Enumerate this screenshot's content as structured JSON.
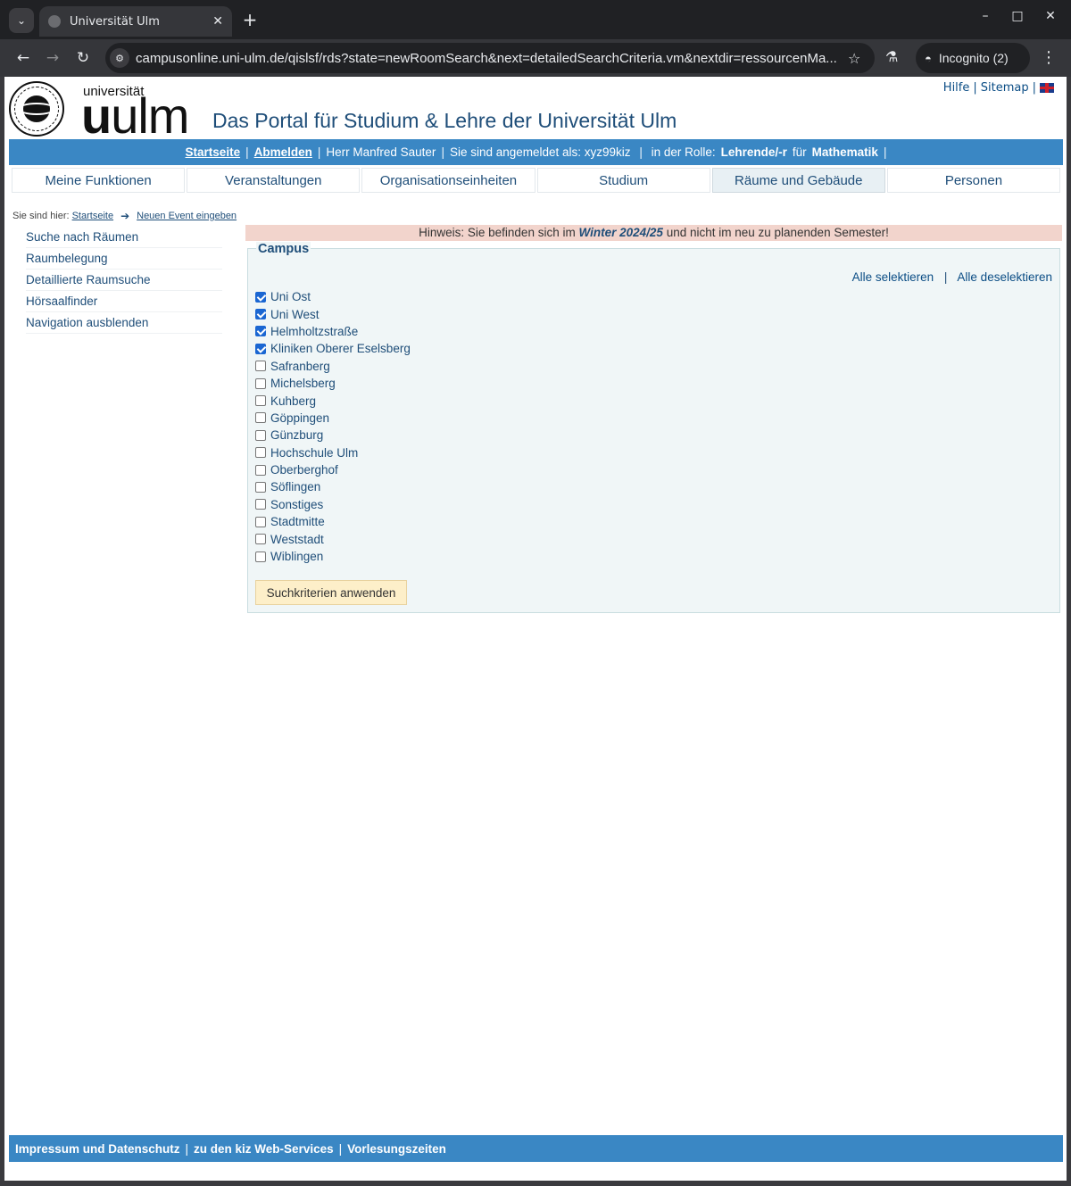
{
  "browser": {
    "tab_title": "Universität Ulm",
    "url": "campusonline.uni-ulm.de/qislsf/rds?state=newRoomSearch&next=detailedSearchCriteria.vm&nextdir=ressourcenMa...",
    "incognito_label": "Incognito (2)"
  },
  "header": {
    "logo_small": "universität",
    "logo_big_bold": "u",
    "logo_big_rest": "ulm",
    "portal_title": "Das Portal für Studium & Lehre der Universität Ulm",
    "help": "Hilfe",
    "sitemap": "Sitemap"
  },
  "userbar": {
    "home": "Startseite",
    "logout": "Abmelden",
    "user": "Herr Manfred Sauter",
    "logged_in_as": "Sie sind angemeldet als: xyz99kiz",
    "role_prefix": "in der Rolle:",
    "role": "Lehrende/-r",
    "for": "für",
    "dept": "Mathematik"
  },
  "mainnav": [
    {
      "label": "Meine Funktionen"
    },
    {
      "label": "Veranstaltungen"
    },
    {
      "label": "Organisationseinheiten"
    },
    {
      "label": "Studium"
    },
    {
      "label": "Räume und Gebäude"
    },
    {
      "label": "Personen"
    }
  ],
  "breadcrumb": {
    "prefix": "Sie sind hier:",
    "home": "Startseite",
    "current": "Neuen Event eingeben"
  },
  "sidenav": [
    {
      "label": "Suche nach Räumen"
    },
    {
      "label": "Raumbelegung"
    },
    {
      "label": "Detaillierte Raumsuche"
    },
    {
      "label": "Hörsaalfinder"
    },
    {
      "label": "Navigation ausblenden"
    }
  ],
  "notice": {
    "before": "Hinweis: Sie befinden sich im",
    "semester": "Winter 2024/25",
    "after": "und nicht im neu zu planenden Semester!"
  },
  "campus": {
    "legend": "Campus",
    "select_all": "Alle selektieren",
    "deselect_all": "Alle deselektieren",
    "items": [
      {
        "label": "Uni Ost",
        "checked": true
      },
      {
        "label": "Uni West",
        "checked": true
      },
      {
        "label": "Helmholtzstraße",
        "checked": true
      },
      {
        "label": "Kliniken Oberer Eselsberg",
        "checked": true
      },
      {
        "label": "Safranberg",
        "checked": false
      },
      {
        "label": "Michelsberg",
        "checked": false
      },
      {
        "label": "Kuhberg",
        "checked": false
      },
      {
        "label": "Göppingen",
        "checked": false
      },
      {
        "label": "Günzburg",
        "checked": false
      },
      {
        "label": "Hochschule Ulm",
        "checked": false
      },
      {
        "label": "Oberberghof",
        "checked": false
      },
      {
        "label": "Söflingen",
        "checked": false
      },
      {
        "label": "Sonstiges",
        "checked": false
      },
      {
        "label": "Stadtmitte",
        "checked": false
      },
      {
        "label": "Weststadt",
        "checked": false
      },
      {
        "label": "Wiblingen",
        "checked": false
      }
    ],
    "apply_button": "Suchkriterien anwenden"
  },
  "footer": {
    "imprint": "Impressum und Datenschutz",
    "kiz": "zu den kiz Web-Services",
    "lectures": "Vorlesungszeiten"
  }
}
